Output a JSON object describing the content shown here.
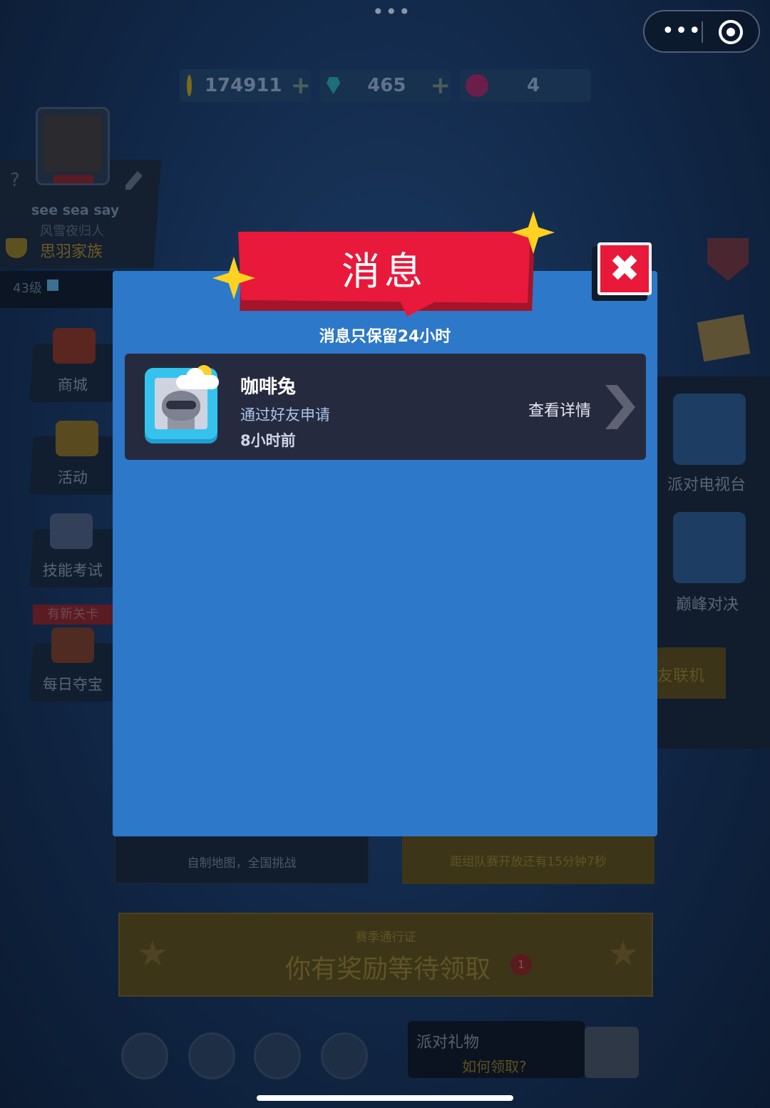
{
  "system": {
    "top_dots": "•••",
    "capsule_more": "•••"
  },
  "currency": {
    "coins": "174911",
    "gems": "465",
    "medals": "4",
    "plus": "+"
  },
  "profile": {
    "help": "?",
    "name": "see sea say",
    "title": "风雪夜归人",
    "family": "思羽家族",
    "level": "43级"
  },
  "left_menu": [
    {
      "label": "商城"
    },
    {
      "label": "活动"
    },
    {
      "label": "技能考试"
    },
    {
      "label": "每日夺宝",
      "badge": "有新关卡"
    }
  ],
  "right_menu": [
    {
      "label": "派对电视台"
    },
    {
      "label": "巅峰对决"
    },
    {
      "label": "友联机"
    }
  ],
  "main_cards": {
    "left_desc": "自制地图，全国挑战",
    "right_desc": "距组队赛开放还有15分钟7秒"
  },
  "season_pass": {
    "label": "赛季通行证",
    "text": "你有奖励等待领取",
    "badge": "1"
  },
  "party_gift": {
    "title": "派对礼物",
    "link": "如何领取?"
  },
  "modal": {
    "title": "消息",
    "close": "✖",
    "subtitle": "消息只保留24小时",
    "messages": [
      {
        "sender": "咖啡兔",
        "action": "通过好友申请",
        "time": "8小时前",
        "detail": "查看详情"
      }
    ]
  },
  "colors": {
    "modal_bg": "#2d78c8",
    "ribbon": "#e8193a",
    "row_bg": "#262a3e",
    "star": "#ffd21f"
  }
}
